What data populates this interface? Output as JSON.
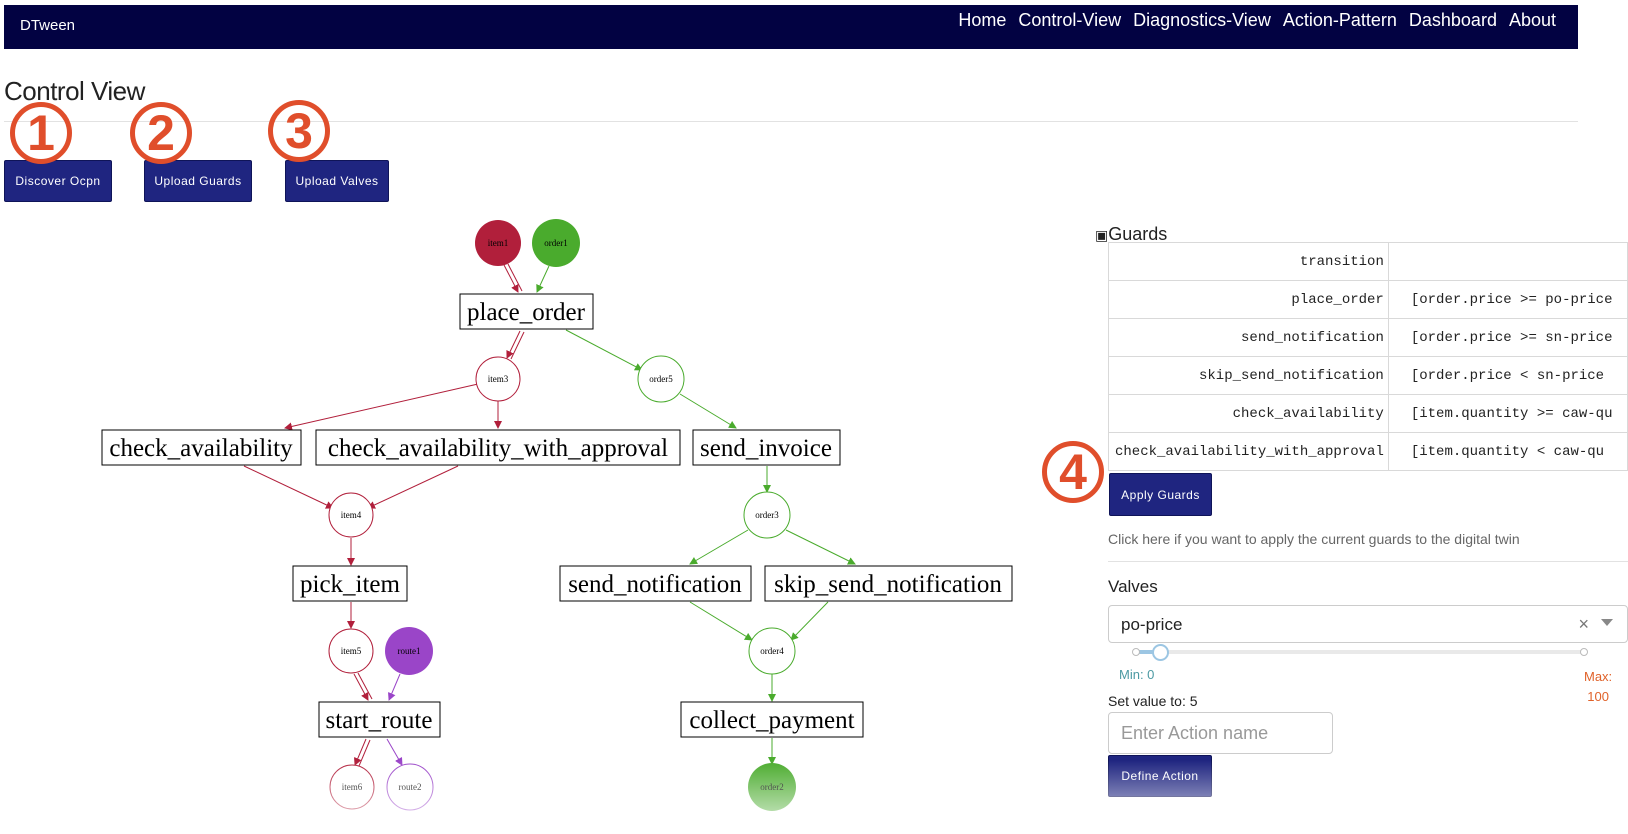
{
  "app": {
    "brand": "DTween",
    "nav": [
      "Home",
      "Control-View",
      "Diagnostics-View",
      "Action-Pattern",
      "Dashboard",
      "About"
    ]
  },
  "page": {
    "title": "Control View"
  },
  "toolbar": {
    "discover_label": "Discover Ocpn",
    "upload_guards_label": "Upload Guards",
    "upload_valves_label": "Upload Valves"
  },
  "callouts": [
    "1",
    "2",
    "3",
    "4"
  ],
  "graph": {
    "places": [
      "item1",
      "order1",
      "item3",
      "order5",
      "item4",
      "order3",
      "item5",
      "route1",
      "order4",
      "item6",
      "route2",
      "order2"
    ],
    "transitions": [
      "place_order",
      "check_availability",
      "check_availability_with_approval",
      "send_invoice",
      "pick_item",
      "send_notification",
      "skip_send_notification",
      "start_route",
      "collect_payment"
    ],
    "colors": {
      "item": "#b11f3b",
      "order": "#4aab2d",
      "route": "#9a45c8"
    }
  },
  "guards": {
    "title": "Guards",
    "header": [
      "transition",
      ""
    ],
    "rows": [
      {
        "transition": "place_order",
        "guard": "[order.price >= po-price"
      },
      {
        "transition": "send_notification",
        "guard": "[order.price >= sn-price"
      },
      {
        "transition": "skip_send_notification",
        "guard": "[order.price < sn-price"
      },
      {
        "transition": "check_availability",
        "guard": "[item.quantity >= caw-qu"
      },
      {
        "transition": "check_availability_with_approval",
        "guard": "[item.quantity < caw-qu"
      }
    ],
    "apply_label": "Apply Guards",
    "apply_hint": "Click here if you want to apply the current guards to the digital twin"
  },
  "valves": {
    "label": "Valves",
    "selected": "po-price",
    "clear_icon": "×",
    "min_label": "Min: 0",
    "max_label": "Max:",
    "max_value": "100",
    "slider_fraction": 0.05,
    "set_value_label": "Set value to: 5",
    "action_placeholder": "Enter Action name",
    "define_label": "Define Action"
  }
}
